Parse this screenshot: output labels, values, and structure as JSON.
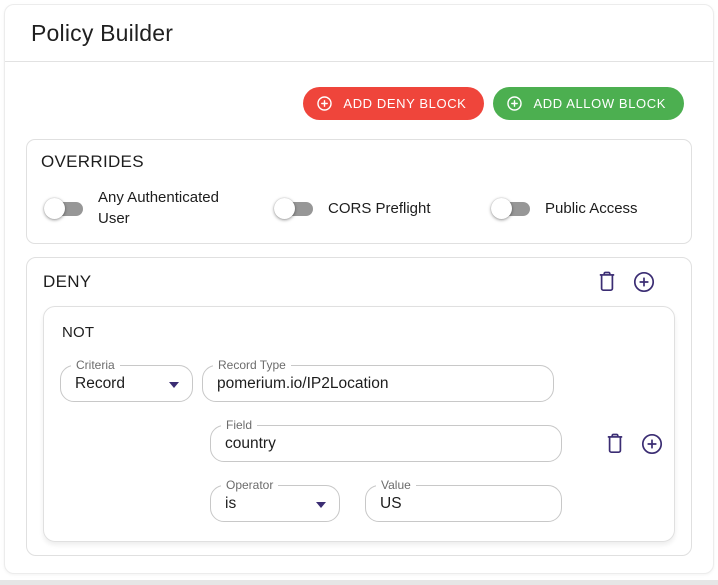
{
  "page": {
    "title": "Policy Builder"
  },
  "toolbar": {
    "add_deny_label": "ADD DENY BLOCK",
    "add_allow_label": "ADD ALLOW BLOCK",
    "deny_color": "#ef453b",
    "allow_color": "#4caf50"
  },
  "overrides": {
    "title": "OVERRIDES",
    "toggles": [
      {
        "label": "Any Authenticated User",
        "state": "off"
      },
      {
        "label": "CORS Preflight",
        "state": "off"
      },
      {
        "label": "Public Access",
        "state": "off"
      }
    ]
  },
  "deny_block": {
    "title": "DENY",
    "group": {
      "label": "NOT",
      "criteria": {
        "label": "Criteria",
        "value": "Record"
      },
      "record_type": {
        "label": "Record Type",
        "value": "pomerium.io/IP2Location"
      },
      "field": {
        "label": "Field",
        "value": "country"
      },
      "operator": {
        "label": "Operator",
        "value": "is"
      },
      "value": {
        "label": "Value",
        "value": "US"
      }
    }
  },
  "icons": {
    "add": "circled-plus-icon",
    "delete": "trash-icon",
    "dropdown": "caret-down-icon"
  },
  "colors": {
    "accent_purple": "#3b2d73",
    "deny_red": "#ef453b",
    "allow_green": "#4caf50",
    "toggle_track_grey": "#979797",
    "border_grey": "#e0e0e0",
    "field_border": "#c8c8c8"
  }
}
